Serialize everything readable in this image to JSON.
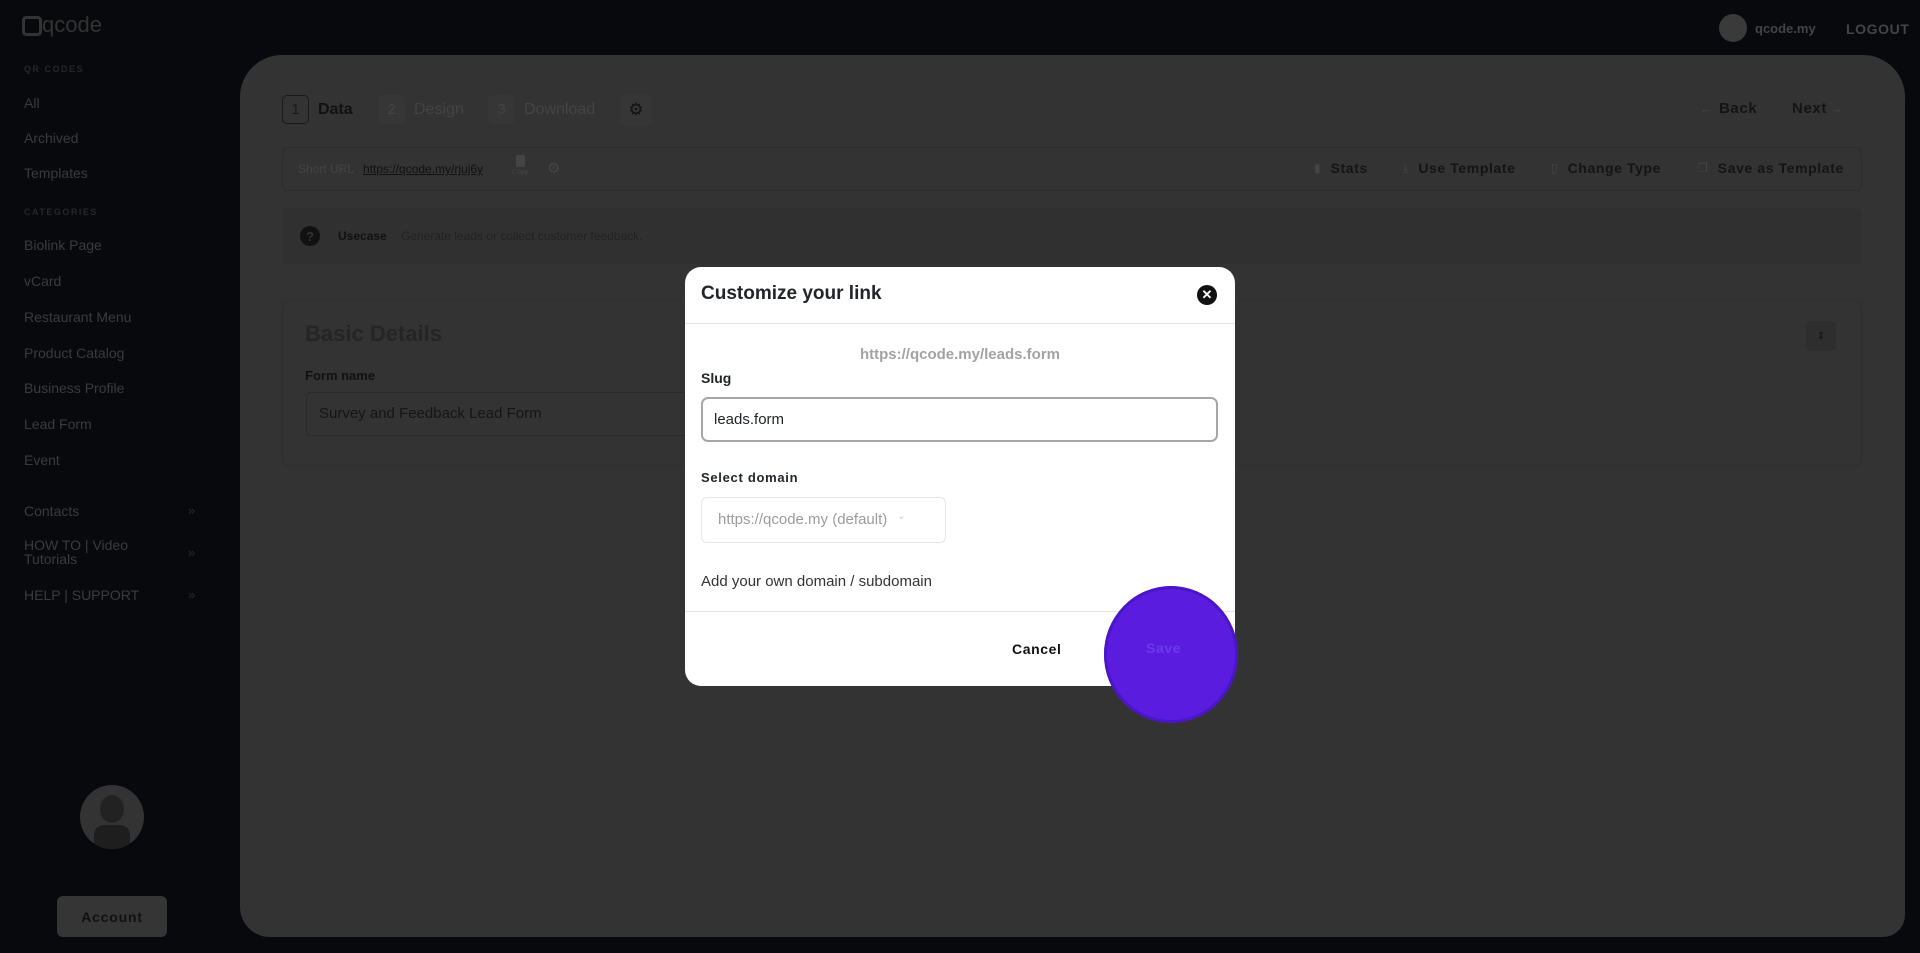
{
  "app": {
    "logo": "qcode",
    "user": "qcode.my",
    "logout": "LOGOUT"
  },
  "sidebar": {
    "section_qr": "QR CODES",
    "qr_items": [
      "All",
      "Archived",
      "Templates"
    ],
    "section_categories": "CATEGORIES",
    "categories": [
      "Biolink Page",
      "vCard",
      "Restaurant Menu",
      "Product Catalog",
      "Business Profile",
      "Lead Form",
      "Event"
    ],
    "links": [
      "Contacts",
      "HOW TO | Video Tutorials",
      "HELP | SUPPORT"
    ],
    "account": "Account"
  },
  "steps": [
    {
      "num": "1",
      "label": "Data"
    },
    {
      "num": "2",
      "label": "Design"
    },
    {
      "num": "3",
      "label": "Download"
    }
  ],
  "nav": {
    "back": "Back",
    "next": "Next"
  },
  "toolbar": {
    "short_url_label": "Short URL",
    "short_url": "https://qcode.my/rjuj6y",
    "copy": "Copy",
    "stats": "Stats",
    "use_template": "Use Template",
    "change_type": "Change Type",
    "save_as_template": "Save as Template"
  },
  "usecase": {
    "label": "Usecase",
    "text": "Generate leads or collect customer feedback."
  },
  "basic": {
    "title": "Basic Details",
    "form_name_label": "Form name",
    "form_name_value": "Survey and Feedback Lead Form"
  },
  "modal": {
    "title": "Customize your link",
    "preview_url": "https://qcode.my/leads.form",
    "slug_label": "Slug",
    "slug_value": "leads.form",
    "domain_label": "Select domain",
    "domain_value": "https://qcode.my (default)",
    "add_domain": "Add your own domain / subdomain",
    "cancel": "Cancel",
    "save": "Save"
  },
  "colors": {
    "accent": "#5a1de0"
  }
}
